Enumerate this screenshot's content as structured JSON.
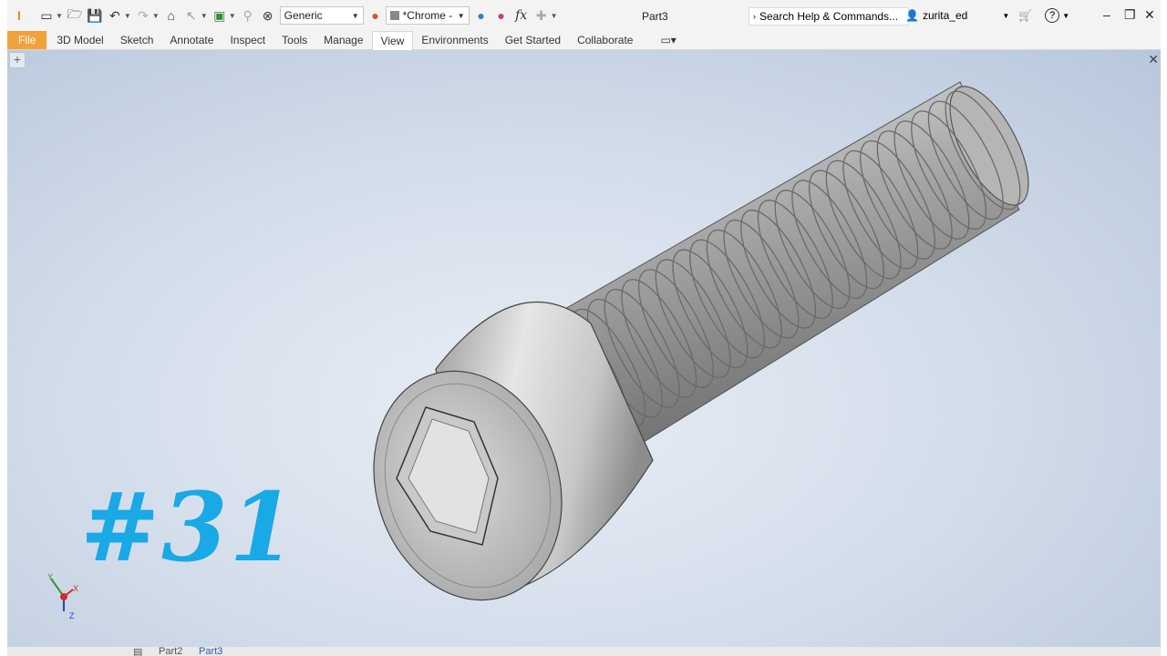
{
  "titlebar": {
    "material": "Generic",
    "appearance": "*Chrome -",
    "document_title": "Part3",
    "search_placeholder": "Search Help & Commands...",
    "user": "zurita_ed"
  },
  "ribbon_tabs": [
    "File",
    "3D Model",
    "Sketch",
    "Annotate",
    "Inspect",
    "Tools",
    "Manage",
    "View",
    "Environments",
    "Get Started",
    "Collaborate"
  ],
  "viewport": {
    "overlay_text": "#31",
    "axis_labels": {
      "x": "X",
      "y": "Y",
      "z": "Z"
    }
  },
  "doc_tabs": [
    "Part2",
    "Part3"
  ],
  "colors": {
    "overlay": "#19a9e6",
    "file_tab": "#f2a23b"
  }
}
